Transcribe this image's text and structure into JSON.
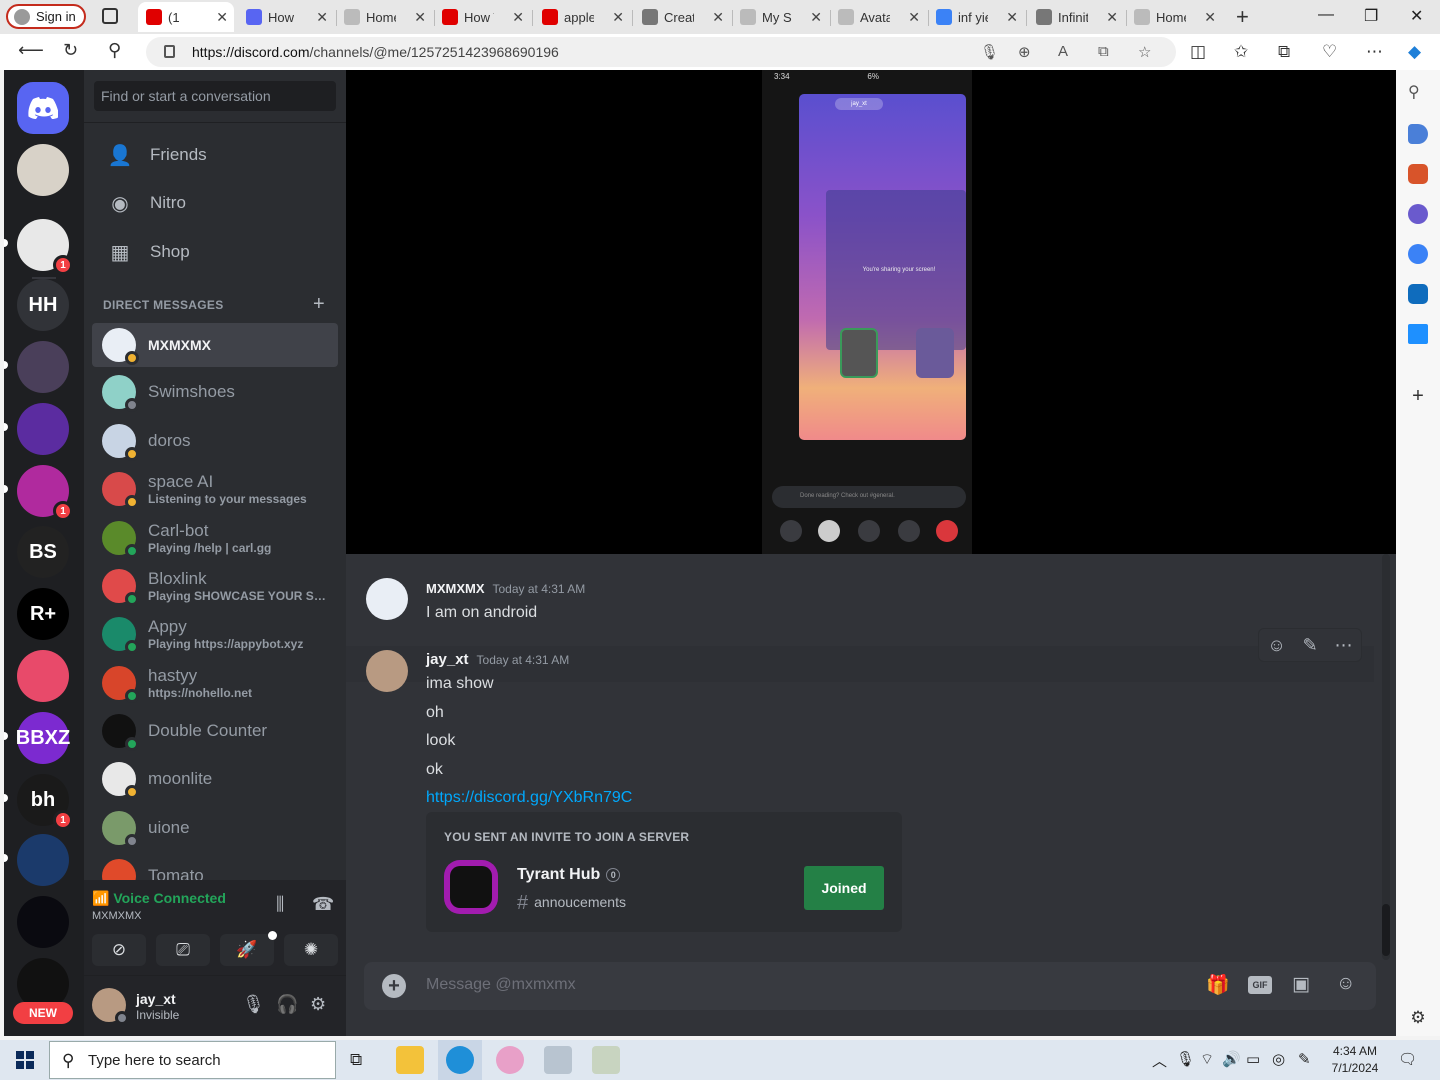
{
  "browser": {
    "signin_label": "Sign in",
    "tabs": [
      {
        "title": "(1",
        "favicon_color": "#e00000",
        "active": true
      },
      {
        "title": "How d",
        "favicon_color": "#5865f2"
      },
      {
        "title": "Home",
        "favicon_color": "#bbbbbb"
      },
      {
        "title": "How T",
        "favicon_color": "#e00000"
      },
      {
        "title": "applev",
        "favicon_color": "#e00000"
      },
      {
        "title": "Create",
        "favicon_color": "#777777"
      },
      {
        "title": "My Se",
        "favicon_color": "#bbbbbb"
      },
      {
        "title": "Avatar",
        "favicon_color": "#bbbbbb"
      },
      {
        "title": "inf yie",
        "favicon_color": "#3b82f6"
      },
      {
        "title": "Infinite",
        "favicon_color": "#777777"
      },
      {
        "title": "Home",
        "favicon_color": "#bbbbbb"
      }
    ],
    "url_host": "https://discord.com",
    "url_path": "/channels/@me/1257251423968690196"
  },
  "guilds": {
    "home_icon": "discord-logo-icon",
    "items": [
      {
        "label": "",
        "color": "#d8d2c8",
        "badge": ""
      },
      {
        "label": "",
        "color": "#e8e8e8",
        "badge": "1"
      },
      {
        "label": "HH",
        "color": "#313338",
        "badge": ""
      },
      {
        "label": "",
        "color": "#4a3f5a",
        "badge": ""
      },
      {
        "label": "",
        "color": "#5b2ca0",
        "badge": ""
      },
      {
        "label": "",
        "color": "#b02a9e",
        "badge": "1"
      },
      {
        "label": "BS",
        "color": "#222222",
        "badge": ""
      },
      {
        "label": "R+",
        "color": "#000000",
        "badge": ""
      },
      {
        "label": "",
        "color": "#e84a6a",
        "badge": ""
      },
      {
        "label": "BBXZ",
        "color": "#7c2ad0",
        "badge": ""
      },
      {
        "label": "bh",
        "color": "#1a1a1a",
        "badge": "1"
      },
      {
        "label": "",
        "color": "#1b3a6b",
        "badge": ""
      },
      {
        "label": "",
        "color": "#0a0a10",
        "badge": ""
      },
      {
        "label": "",
        "color": "#111111",
        "badge": ""
      }
    ],
    "new_label": "NEW"
  },
  "dm_column": {
    "search_placeholder": "Find or start a conversation",
    "nav": [
      {
        "label": "Friends",
        "icon": "friends-icon"
      },
      {
        "label": "Nitro",
        "icon": "nitro-icon"
      },
      {
        "label": "Shop",
        "icon": "shop-icon"
      }
    ],
    "header": "DIRECT MESSAGES",
    "dms": [
      {
        "name": "MXMXMX",
        "sub": "",
        "avatar": "#e9eef5",
        "status": "#f0b232",
        "selected": true
      },
      {
        "name": "Swimshoes",
        "sub": "",
        "avatar": "#8fd1c8",
        "status": "#80848e"
      },
      {
        "name": "doros",
        "sub": "",
        "avatar": "#c8d4e4",
        "status": "#f0b232"
      },
      {
        "name": "space AI",
        "sub": "Listening to your messages",
        "avatar": "#d84a4a",
        "status": "#f0b232"
      },
      {
        "name": "Carl-bot",
        "sub": "Playing /help | carl.gg",
        "avatar": "#5a8a2a",
        "status": "#23a55a"
      },
      {
        "name": "Bloxlink",
        "sub": "Playing SHOWCASE YOUR SERVER",
        "avatar": "#e04a4a",
        "status": "#23a55a"
      },
      {
        "name": "Appy",
        "sub": "Playing https://appybot.xyz",
        "avatar": "#1a8a6a",
        "status": "#23a55a"
      },
      {
        "name": "hastyy",
        "sub": "https://nohello.net",
        "avatar": "#d8452a",
        "status": "#23a55a"
      },
      {
        "name": "Double Counter",
        "sub": "",
        "avatar": "#111111",
        "status": "#23a55a"
      },
      {
        "name": "moonlite",
        "sub": "",
        "avatar": "#e8e8e8",
        "status": "#f0b232"
      },
      {
        "name": "uione",
        "sub": "",
        "avatar": "#7a9a6a",
        "status": "#80848e"
      },
      {
        "name": "Tomato",
        "sub": "",
        "avatar": "#e04a2a",
        "status": "#23a55a"
      }
    ]
  },
  "voice": {
    "title": "Voice Connected",
    "channel": "MXMXMX"
  },
  "user": {
    "name": "jay_xt",
    "status": "Invisible"
  },
  "stream": {
    "phone_time": "3:34",
    "phone_battery": "6%",
    "phone_peer": "jay_xt",
    "share_text": "You're sharing your screen!",
    "phone_input": "Done reading? Check out #general."
  },
  "messages": [
    {
      "author": "MXMXMX",
      "time": "Today at 4:31 AM",
      "lines": [
        "I am on android"
      ],
      "avatar": "#e9eef5"
    },
    {
      "author": "jay_xt",
      "time": "Today at 4:31 AM",
      "lines": [
        "ima show",
        "oh",
        "look",
        "ok"
      ],
      "link": "https://discord.gg/YXbRn79C",
      "avatar": "#b89a82"
    }
  ],
  "invite": {
    "heading": "YOU SENT AN INVITE TO JOIN A SERVER",
    "server": "Tyrant Hub",
    "count": "0",
    "channel": "annoucements",
    "button": "Joined"
  },
  "composer": {
    "placeholder": "Message @mxmxmx",
    "gif_label": "GIF"
  },
  "taskbar": {
    "search_placeholder": "Type here to search",
    "time": "4:34 AM",
    "date": "7/1/2024"
  }
}
